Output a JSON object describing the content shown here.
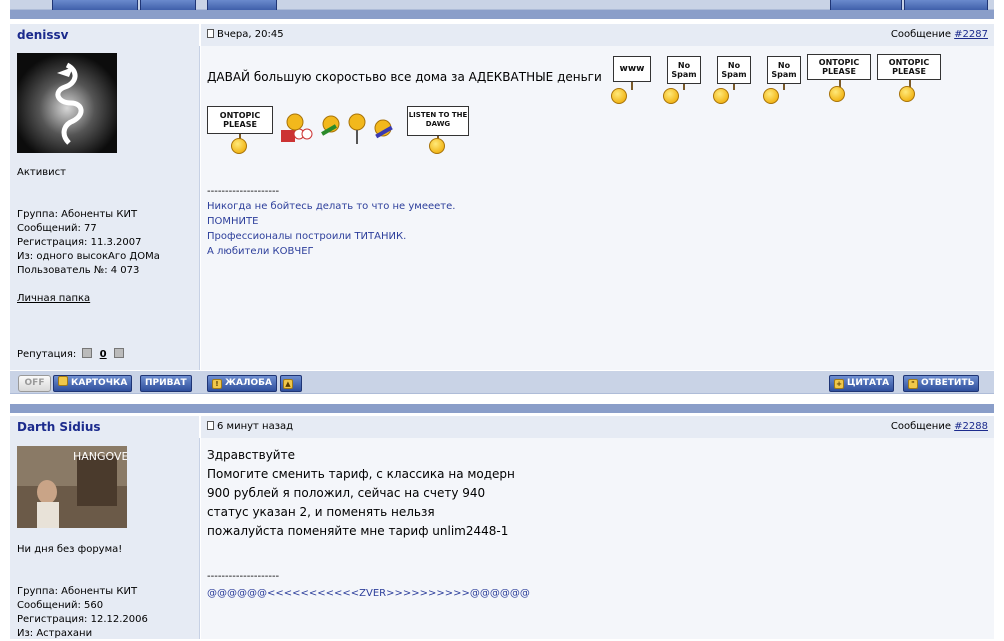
{
  "post1": {
    "author": "denissv",
    "date": "Вчера, 20:45",
    "msg_prefix": "Сообщение ",
    "msg_number": "#2287",
    "rank": "Активист",
    "group": "Группа: Абоненты КИТ",
    "posts": "Сообщений: 77",
    "registered": "Регистрация: 11.3.2007",
    "from": "Из: одного высокАго ДОМа",
    "user_no": "Пользователь №: 4 073",
    "folder_link": "Личная папка",
    "reputation_label": "Репутация:",
    "reputation_value": "0",
    "text": "ДАВАЙ большую скоростьво все дома за АДЕКВАТНЫЕ деньги",
    "sig_dash": "--------------------",
    "sig": [
      "Никогда не бойтесь делать то что не умееете.",
      "ПОМНИТЕ",
      "Профессионалы построили ТИТАНИК.",
      "А любители КОВЧЕГ"
    ],
    "smiley_signs": [
      "www",
      "No Spam",
      "No Spam",
      "No Spam",
      "ONTOPIC PLEASE",
      "ONTOPIC PLEASE",
      "ONTOPIC PLEASE",
      "LISTEN TO THE DAWG"
    ]
  },
  "bar": {
    "off": "OFF",
    "card": "КАРТОЧКА",
    "privat": "ПРИВАТ",
    "complaint": "ЖАЛОБА",
    "quote": "ЦИТАТА",
    "reply": "ОТВЕТИТЬ"
  },
  "post2": {
    "author": "Darth Sidius",
    "date": "6 минут назад",
    "msg_prefix": "Сообщение ",
    "msg_number": "#2288",
    "avatar_text": "HANGOVER",
    "rank": "Ни дня без форума!",
    "group": "Группа: Абоненты КИТ",
    "posts": "Сообщений: 560",
    "registered": "Регистрация: 12.12.2006",
    "from": "Из: Астрахани",
    "lines": [
      "Здравствуйте",
      "Помогите сменить тариф, с классика на модерн",
      "900 рублей я положил, сейчас на счету 940",
      "статус указан 2, и поменять нельзя",
      "пожалуйста поменяйте мне тариф unlim2448-1"
    ],
    "sig_dash": "--------------------",
    "sig": "@@@@@@<<<<<<<<<<<ZVER>>>>>>>>>>@@@@@@"
  },
  "colors": {
    "bar": "#c9d3e6",
    "separator": "#8a9ec9",
    "author": "#1c2b8d",
    "button": "#2f4f9c",
    "signature": "#2c3e9b"
  }
}
